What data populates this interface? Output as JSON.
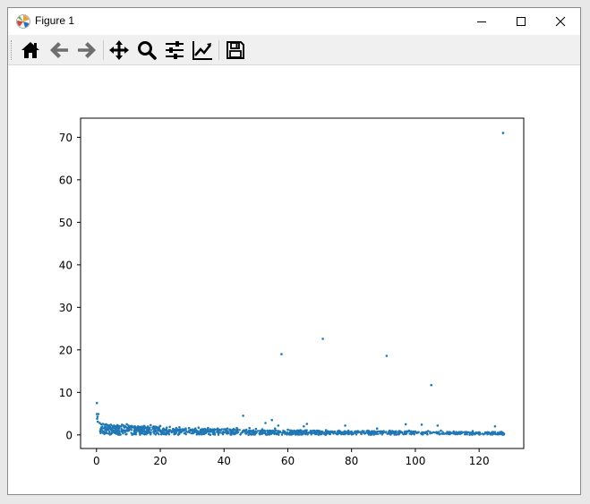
{
  "window": {
    "title": "Figure 1",
    "app_icon": "matplotlib-icon",
    "controls": [
      "minimize-icon",
      "maximize-icon",
      "close-icon"
    ]
  },
  "toolbar": {
    "buttons": [
      {
        "name": "home-icon"
      },
      {
        "name": "back-arrow-icon"
      },
      {
        "name": "forward-arrow-icon"
      },
      {
        "name": "pan-move-icon"
      },
      {
        "name": "zoom-magnifier-icon"
      },
      {
        "name": "configure-subplots-icon"
      },
      {
        "name": "edit-axis-line-icon"
      },
      {
        "name": "save-floppy-icon"
      }
    ]
  },
  "chart_data": {
    "type": "scatter",
    "title": "",
    "xlabel": "",
    "ylabel": "",
    "xlim": [
      -5,
      134
    ],
    "ylim": [
      -3.2,
      74.5
    ],
    "xticks": [
      0,
      20,
      40,
      60,
      80,
      100,
      120
    ],
    "yticks": [
      0,
      10,
      20,
      30,
      40,
      50,
      60,
      70
    ],
    "color": "#1f77b4",
    "grid": false,
    "legend": "none",
    "series": [
      {
        "points": [
          [
            0.1,
            7.5
          ],
          [
            0.1,
            4.9
          ],
          [
            0.3,
            4.3
          ],
          [
            0.2,
            3.8
          ],
          [
            0.4,
            3.1
          ],
          [
            0.6,
            4.9
          ],
          [
            1,
            2.8
          ],
          [
            1.5,
            2.5
          ],
          [
            2,
            2.6
          ],
          [
            2.5,
            2.4
          ],
          [
            3,
            2.5
          ],
          [
            3.5,
            2.3
          ],
          [
            4,
            2.2
          ],
          [
            4.5,
            2.4
          ],
          [
            5,
            2.1
          ],
          [
            5.5,
            2.2
          ],
          [
            6,
            2.0
          ],
          [
            6.5,
            2.3
          ],
          [
            7,
            2.1
          ],
          [
            7.5,
            2.0
          ],
          [
            8,
            2.4
          ],
          [
            8.5,
            2.2
          ],
          [
            9,
            2.0
          ],
          [
            9.5,
            2.5
          ],
          [
            10,
            2.2
          ],
          [
            10.5,
            2.0
          ],
          [
            11,
            2.1
          ],
          [
            11.5,
            1.9
          ],
          [
            12,
            2.0
          ],
          [
            13,
            1.8
          ],
          [
            14,
            1.9
          ],
          [
            15,
            2.1
          ],
          [
            16,
            1.7
          ],
          [
            17,
            2.3
          ],
          [
            18,
            1.6
          ],
          [
            19,
            1.8
          ],
          [
            20,
            2.1
          ],
          [
            21,
            1.5
          ],
          [
            22,
            1.7
          ],
          [
            23,
            1.9
          ],
          [
            24,
            1.4
          ],
          [
            25,
            1.6
          ],
          [
            26,
            1.8
          ],
          [
            27,
            1.3
          ],
          [
            28,
            1.5
          ],
          [
            29,
            1.6
          ],
          [
            30,
            1.2
          ],
          [
            31,
            1.5
          ],
          [
            32,
            1.7
          ],
          [
            33,
            1.3
          ],
          [
            34,
            1.4
          ],
          [
            35,
            1.6
          ],
          [
            36,
            1.2
          ],
          [
            37,
            1.3
          ],
          [
            38,
            1.5
          ],
          [
            39,
            1.1
          ],
          [
            40,
            1.3
          ],
          [
            41,
            1.5
          ],
          [
            42,
            1.2
          ],
          [
            43,
            1.4
          ],
          [
            44,
            1.6
          ],
          [
            46,
            4.5
          ],
          [
            47,
            1.2
          ],
          [
            48,
            1.6
          ],
          [
            50,
            1.4
          ],
          [
            52,
            1.3
          ],
          [
            53,
            2.8
          ],
          [
            55,
            3.5
          ],
          [
            56,
            1.5
          ],
          [
            57,
            2.2
          ],
          [
            58,
            19.0
          ],
          [
            60,
            1.2
          ],
          [
            62,
            1.0
          ],
          [
            64,
            1.1
          ],
          [
            65,
            2.0
          ],
          [
            66,
            2.6
          ],
          [
            68,
            1.0
          ],
          [
            70,
            0.9
          ],
          [
            71,
            22.6
          ],
          [
            72,
            1.1
          ],
          [
            74,
            0.8
          ],
          [
            76,
            1.0
          ],
          [
            78,
            2.2
          ],
          [
            79,
            1.0
          ],
          [
            82,
            0.9
          ],
          [
            85,
            1.0
          ],
          [
            88,
            1.5
          ],
          [
            91,
            18.6
          ],
          [
            92,
            1.0
          ],
          [
            95,
            0.9
          ],
          [
            97,
            2.5
          ],
          [
            98,
            1.0
          ],
          [
            100,
            0.8
          ],
          [
            102,
            2.4
          ],
          [
            104,
            0.9
          ],
          [
            105,
            11.7
          ],
          [
            107,
            2.2
          ],
          [
            108,
            1.0
          ],
          [
            110,
            0.7
          ],
          [
            112,
            0.8
          ],
          [
            114,
            0.6
          ],
          [
            116,
            0.7
          ],
          [
            118,
            0.9
          ],
          [
            120,
            0.6
          ],
          [
            122,
            0.5
          ],
          [
            124,
            0.6
          ],
          [
            125,
            2.0
          ],
          [
            126,
            0.5
          ],
          [
            127.5,
            71.0
          ]
        ],
        "bands": [
          {
            "x": [
              1,
              20
            ],
            "y": [
              0.0,
              2.0
            ],
            "n": 320
          },
          {
            "x": [
              20,
              45
            ],
            "y": [
              0.0,
              1.4
            ],
            "n": 300
          },
          {
            "x": [
              45,
              70
            ],
            "y": [
              0.0,
              1.1
            ],
            "n": 260
          },
          {
            "x": [
              70,
              100
            ],
            "y": [
              0.0,
              0.9
            ],
            "n": 260
          },
          {
            "x": [
              100,
              128
            ],
            "y": [
              0.0,
              0.7
            ],
            "n": 200
          }
        ]
      }
    ]
  }
}
